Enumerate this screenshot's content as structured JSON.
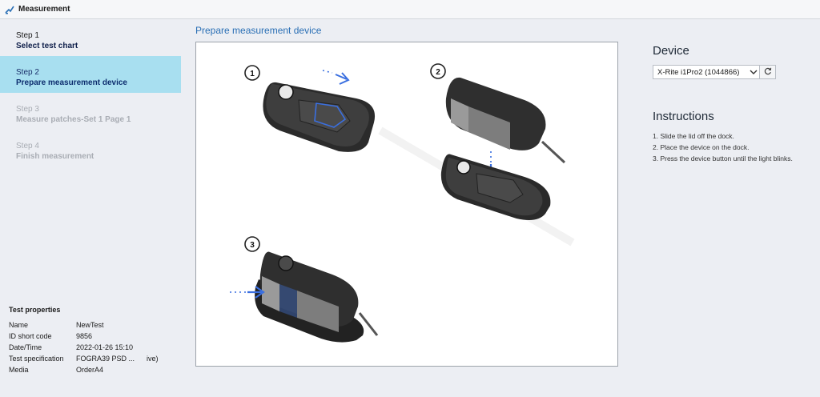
{
  "titlebar": {
    "title": "Measurement",
    "icon": "measurement-icon"
  },
  "steps": [
    {
      "number": "Step 1",
      "name": "Select test chart",
      "state": "done"
    },
    {
      "number": "Step 2",
      "name": "Prepare measurement device",
      "state": "active"
    },
    {
      "number": "Step 3",
      "name": "Measure patches-Set 1 Page 1",
      "state": "disabled"
    },
    {
      "number": "Step 4",
      "name": "Finish measurement",
      "state": "disabled"
    }
  ],
  "test_properties": {
    "heading": "Test properties",
    "rows": [
      {
        "key": "Name",
        "value": "NewTest"
      },
      {
        "key": "ID short code",
        "value": "9856"
      },
      {
        "key": "Date/Time",
        "value": "2022-01-26 15:10"
      },
      {
        "key": "Test specification",
        "value": "FOGRA39 PSD ...      ive)"
      },
      {
        "key": "Media",
        "value": "OrderA4"
      }
    ]
  },
  "main": {
    "title": "Prepare measurement device",
    "figure_labels": [
      "1",
      "2",
      "3"
    ]
  },
  "device": {
    "title": "Device",
    "selected": "X-Rite i1Pro2 (1044866)",
    "refresh_icon": "refresh-icon"
  },
  "instructions": {
    "title": "Instructions",
    "items": [
      "1.  Slide the lid off the dock.",
      "2.  Place the device on the dock.",
      "3.  Press the device button until the light blinks."
    ]
  },
  "colors": {
    "accent": "#2a6fb5",
    "active_step": "#a8dff0",
    "arrow": "#3a6fe0"
  }
}
